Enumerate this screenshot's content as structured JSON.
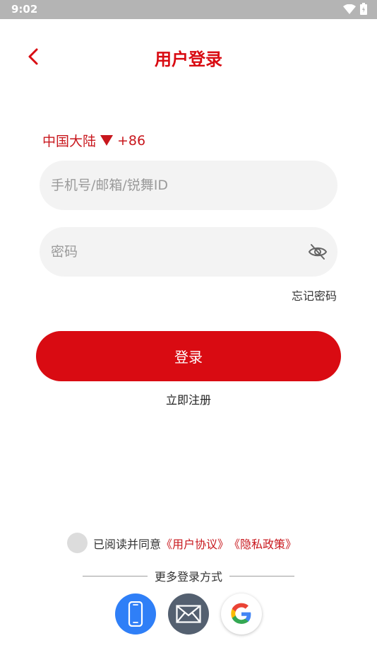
{
  "status_bar": {
    "time": "9:02"
  },
  "header": {
    "title": "用户登录"
  },
  "login_form": {
    "region_label": "中国大陆",
    "country_code": "+86",
    "account_placeholder": "手机号/邮箱/锐舞ID",
    "password_placeholder": "密码",
    "forgot_password": "忘记密码",
    "login_button": "登录",
    "register_link": "立即注册"
  },
  "agreement": {
    "prefix": "已阅读并同意",
    "user_agreement": "《用户协议》",
    "privacy_policy": "《隐私政策》"
  },
  "alt_login": {
    "title": "更多登录方式",
    "methods": [
      "phone-icon",
      "mail-icon",
      "google-icon"
    ]
  },
  "colors": {
    "accent": "#d90b12",
    "phone": "#2f7ff7",
    "mail": "#546070"
  }
}
